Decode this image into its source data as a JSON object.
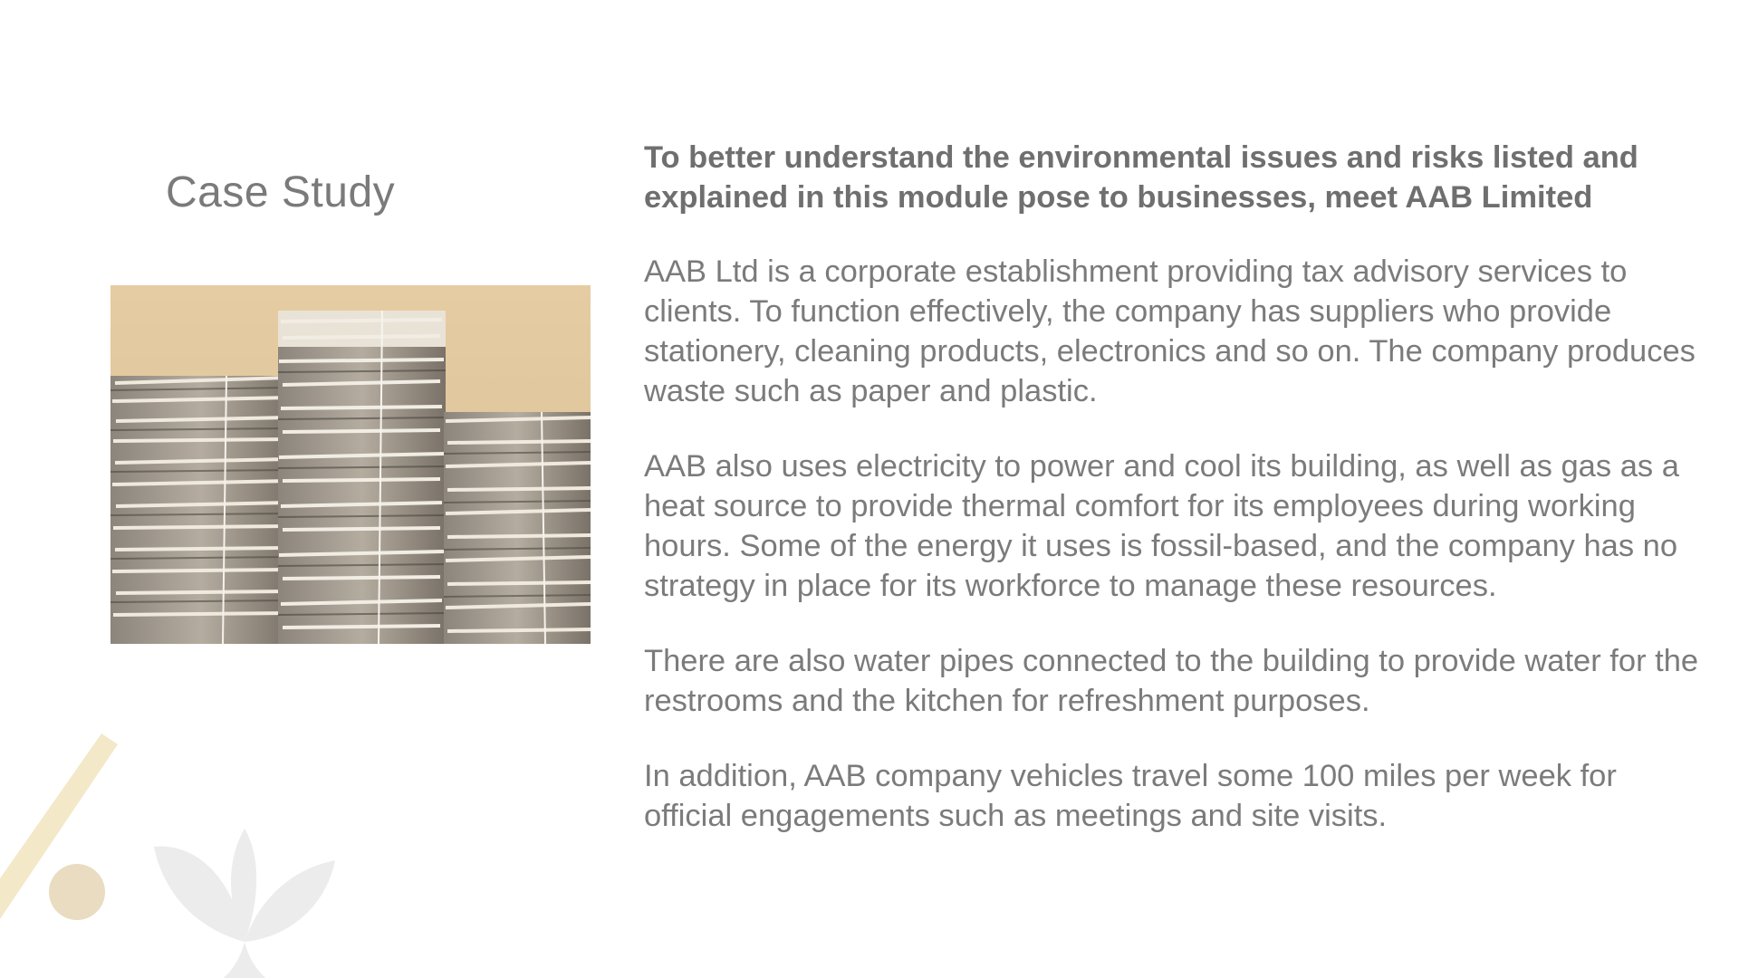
{
  "slide": {
    "title": "Case Study",
    "paragraphs": {
      "lead": "To better understand the environmental issues and risks listed and explained in this module pose to businesses, meet AAB Limited",
      "p1": "AAB Ltd is a corporate establishment providing tax advisory services to clients. To function effectively, the company has suppliers who provide stationery, cleaning products, electronics and so on. The company produces waste such as paper and plastic.",
      "p2": "AAB also uses electricity to power and cool its building, as well as gas as a heat source to provide thermal comfort for its employees during working hours. Some of the energy it uses is fossil-based, and the company has no strategy in place for its workforce to manage these resources.",
      "p3": "There are also water pipes connected to the building to provide water for the restrooms and the kitchen for refreshment purposes.",
      "p4": "In addition, AAB company vehicles travel some 100 miles per week for official engagements such as meetings and site visits."
    },
    "image": {
      "icon": "stacked-paper-photo"
    },
    "colors": {
      "text": "#7b7b7b",
      "accent_yellow": "#f3e8c8",
      "accent_dot": "#e9dcc0",
      "leaf": "#ececec",
      "photo_wall": "#e8cfa6"
    }
  }
}
